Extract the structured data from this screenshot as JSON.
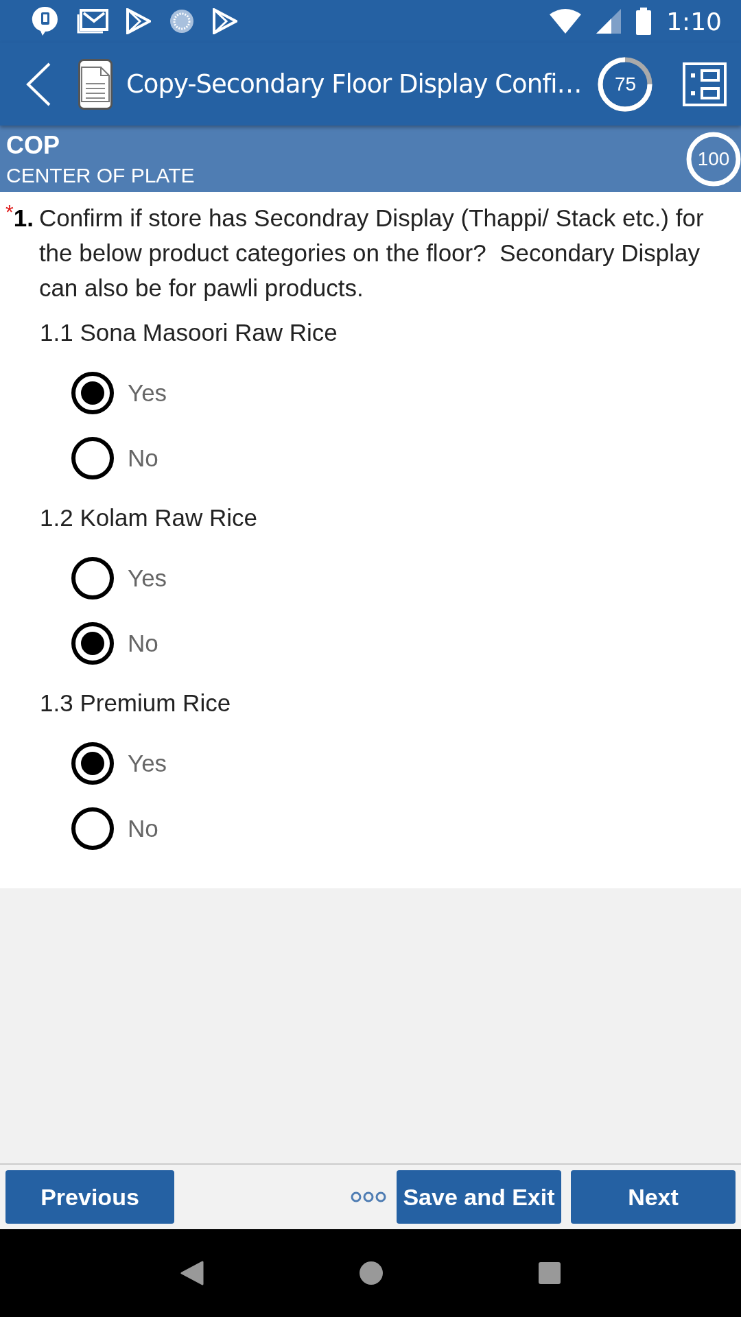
{
  "status_bar": {
    "time": "1:10"
  },
  "header": {
    "title": "Copy-Secondary Floor Display Confi…",
    "progress": {
      "label": "75",
      "level": 0.75
    }
  },
  "section": {
    "code": "COP",
    "name": "CENTER OF PLATE",
    "progress": {
      "label": "100",
      "level": 1
    }
  },
  "question": {
    "required_mark": "*",
    "number": "1.",
    "text": "Confirm if store has Secondray Display (Thappi/ Stack etc.) for the below product categories on the floor?  Secondary Display can also be for pawli products."
  },
  "items": [
    {
      "label": "1.1 Sona Masoori Raw Rice",
      "options": [
        {
          "label": "Yes",
          "selected": true
        },
        {
          "label": "No",
          "selected": false
        }
      ]
    },
    {
      "label": "1.2 Kolam Raw Rice",
      "options": [
        {
          "label": "Yes",
          "selected": false
        },
        {
          "label": "No",
          "selected": true
        }
      ]
    },
    {
      "label": "1.3 Premium Rice",
      "options": [
        {
          "label": "Yes",
          "selected": true
        },
        {
          "label": "No",
          "selected": false
        }
      ]
    }
  ],
  "footer": {
    "previous": "Previous",
    "save": "Save and Exit",
    "next": "Next"
  }
}
